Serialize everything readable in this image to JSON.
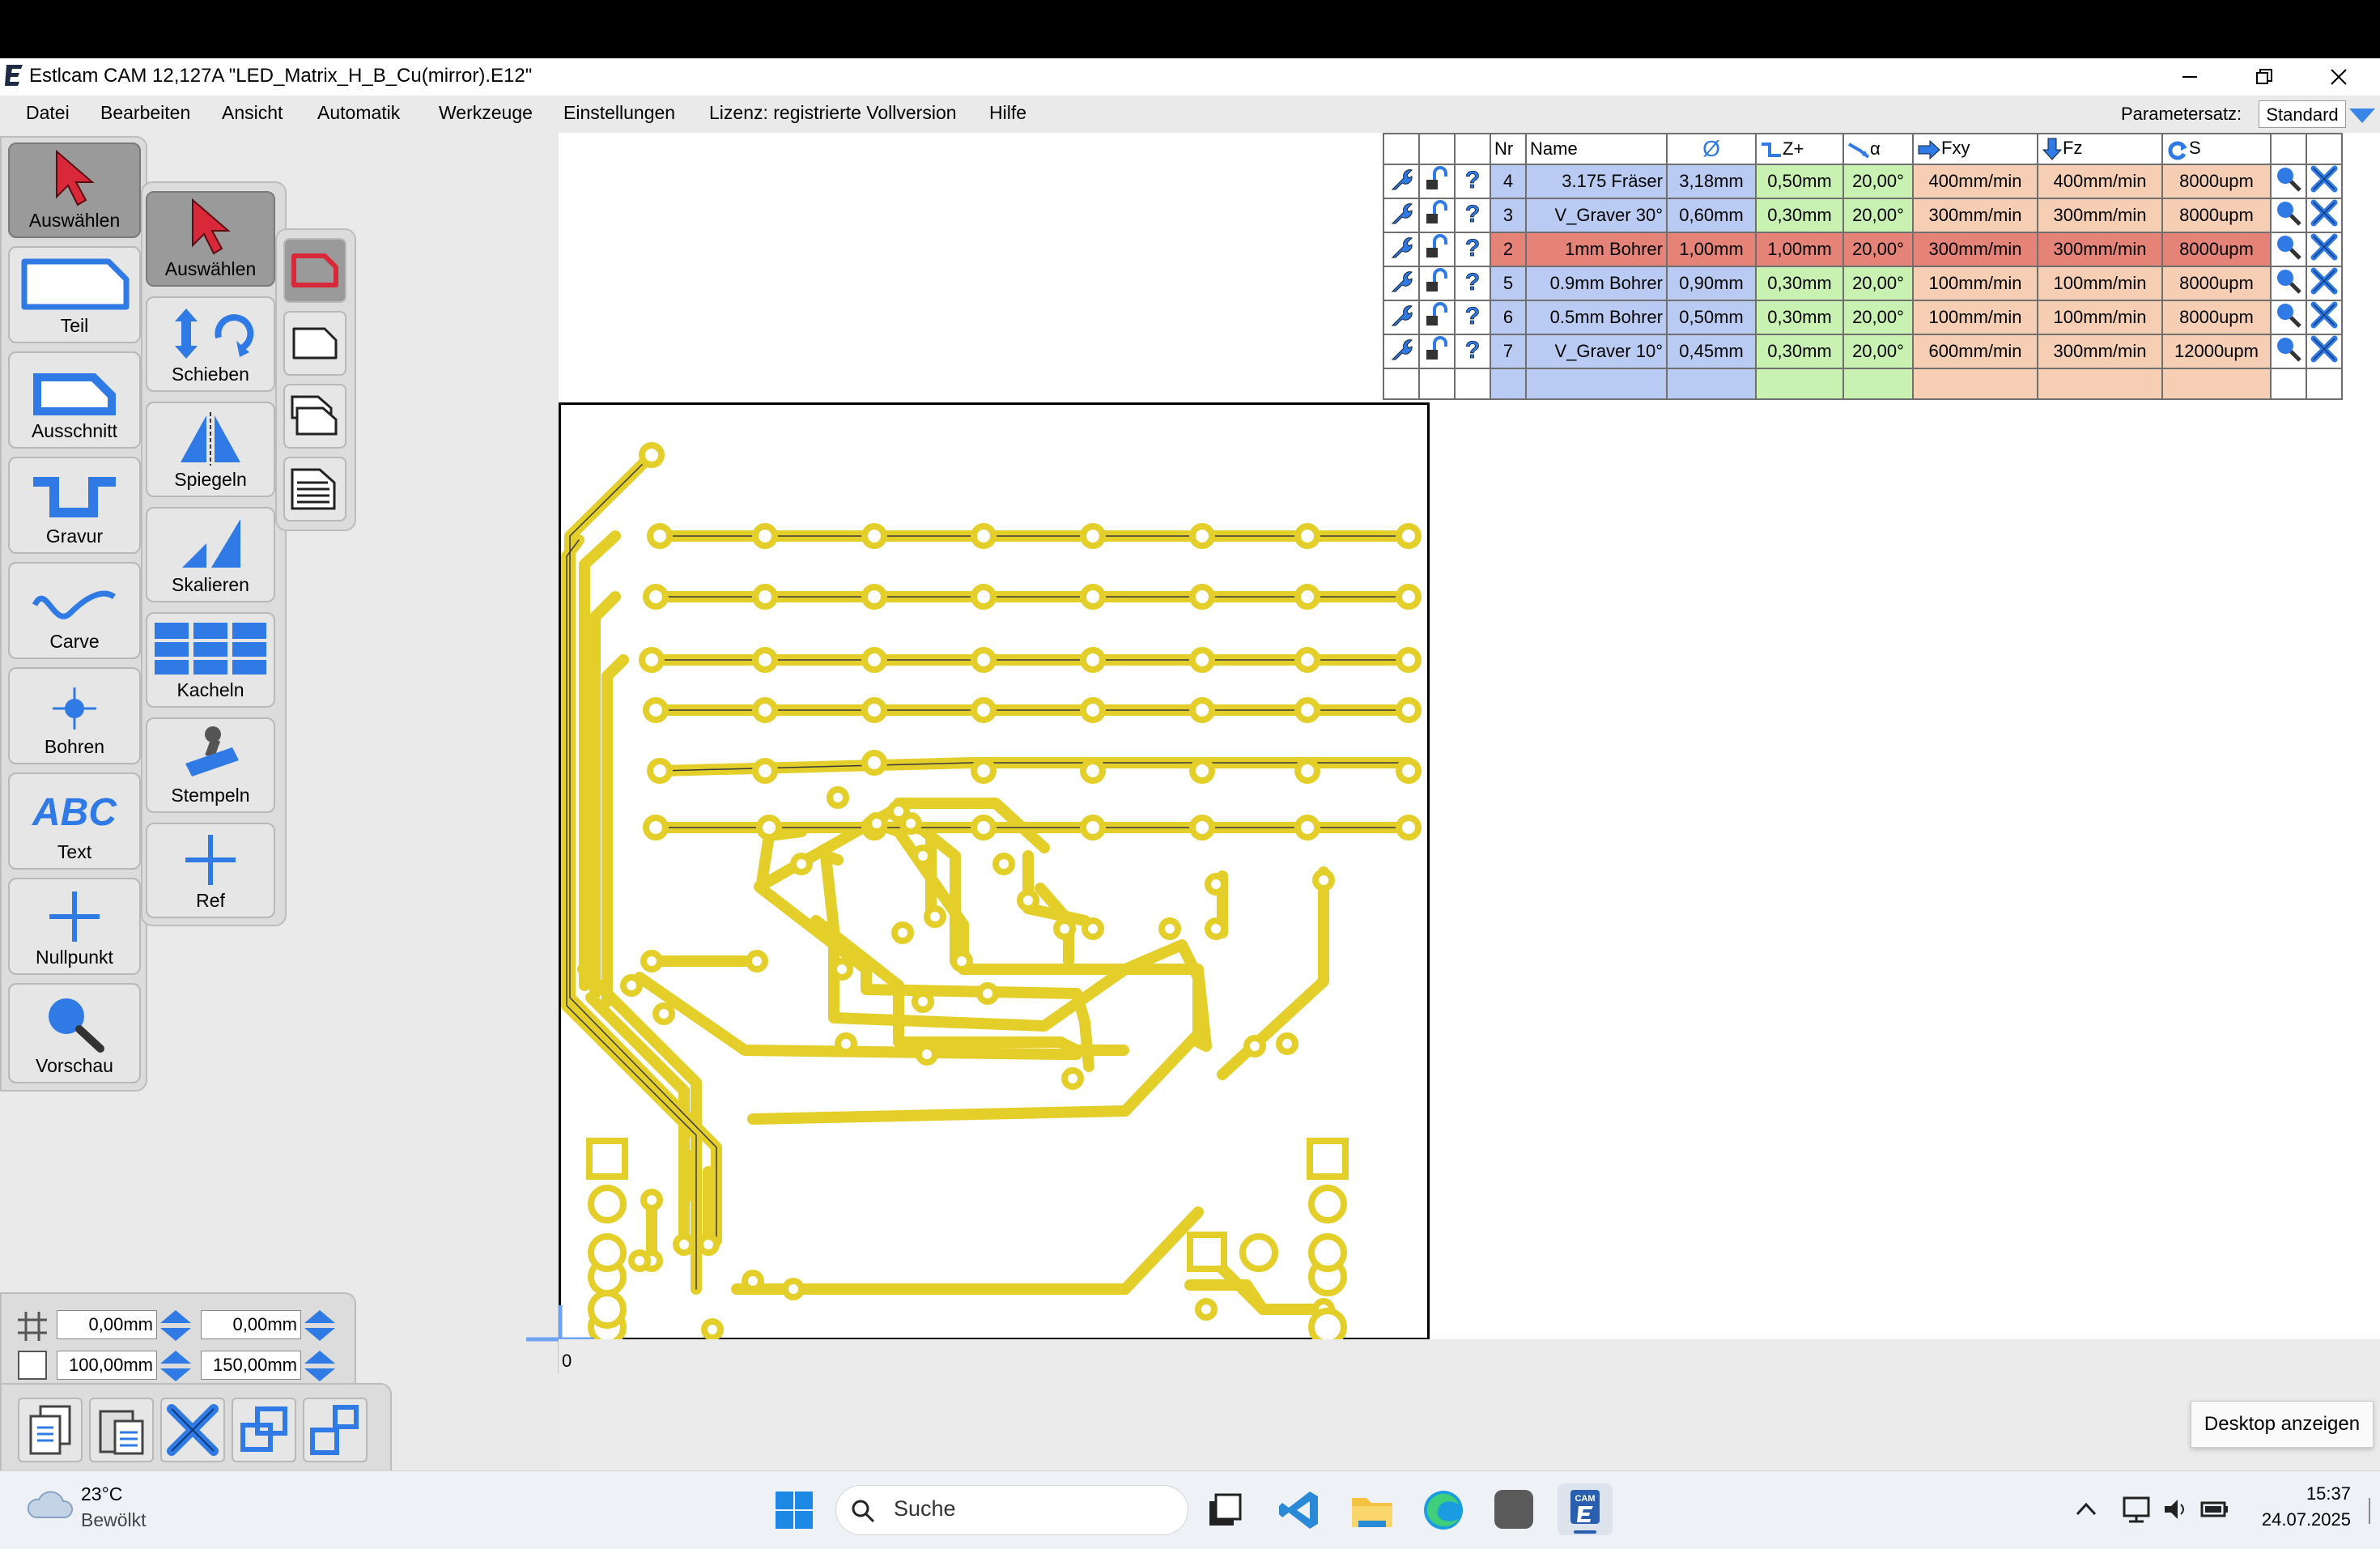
{
  "window": {
    "title": "Estlcam CAM 12,127A \"LED_Matrix_H_B_Cu(mirror).E12\"",
    "controls": [
      "minimize",
      "restore",
      "close"
    ]
  },
  "menu": [
    "Datei",
    "Bearbeiten",
    "Ansicht",
    "Automatik",
    "Werkzeuge",
    "Einstellungen",
    "Lizenz: registrierte Vollversion",
    "Hilfe"
  ],
  "paramset": {
    "label": "Parametersatz:",
    "value": "Standard"
  },
  "toolbar_left": [
    {
      "label": "Auswählen",
      "icon": "cursor-icon",
      "active": true
    },
    {
      "label": "Teil",
      "icon": "part-icon"
    },
    {
      "label": "Ausschnitt",
      "icon": "pocket-icon"
    },
    {
      "label": "Gravur",
      "icon": "engrave-icon"
    },
    {
      "label": "Carve",
      "icon": "carve-icon"
    },
    {
      "label": "Bohren",
      "icon": "drill-icon"
    },
    {
      "label": "Text",
      "icon": "text-icon",
      "glyph": "ABC"
    },
    {
      "label": "Nullpunkt",
      "icon": "zero-point-icon"
    },
    {
      "label": "Vorschau",
      "icon": "preview-icon"
    }
  ],
  "toolbar_right": [
    {
      "label": "Auswählen",
      "icon": "cursor-icon",
      "active": true
    },
    {
      "label": "Schieben",
      "icon": "move-rotate-icon"
    },
    {
      "label": "Spiegeln",
      "icon": "mirror-icon"
    },
    {
      "label": "Skalieren",
      "icon": "scale-icon"
    },
    {
      "label": "Kacheln",
      "icon": "tile-icon"
    },
    {
      "label": "Stempeln",
      "icon": "stamp-icon"
    },
    {
      "label": "Ref",
      "icon": "ref-icon"
    }
  ],
  "tool_table": {
    "headers": {
      "nr": "Nr",
      "name": "Name",
      "diameter": "Ø",
      "z": "Z+",
      "angle": "α",
      "fxy": "Fxy",
      "fz": "Fz",
      "s": "S"
    },
    "rows": [
      {
        "nr": "4",
        "name": "3.175 Fräser",
        "dia": "3,18mm",
        "z": "0,50mm",
        "a": "20,00°",
        "fxy": "400mm/min",
        "fz": "400mm/min",
        "s": "8000upm",
        "selected": false
      },
      {
        "nr": "3",
        "name": "V_Graver 30°",
        "dia": "0,60mm",
        "z": "0,30mm",
        "a": "20,00°",
        "fxy": "300mm/min",
        "fz": "300mm/min",
        "s": "8000upm",
        "selected": false
      },
      {
        "nr": "2",
        "name": "1mm Bohrer",
        "dia": "1,00mm",
        "z": "1,00mm",
        "a": "20,00°",
        "fxy": "300mm/min",
        "fz": "300mm/min",
        "s": "8000upm",
        "selected": true
      },
      {
        "nr": "5",
        "name": "0.9mm Bohrer",
        "dia": "0,90mm",
        "z": "0,30mm",
        "a": "20,00°",
        "fxy": "100mm/min",
        "fz": "100mm/min",
        "s": "8000upm",
        "selected": false
      },
      {
        "nr": "6",
        "name": "0.5mm Bohrer",
        "dia": "0,50mm",
        "z": "0,30mm",
        "a": "20,00°",
        "fxy": "100mm/min",
        "fz": "100mm/min",
        "s": "8000upm",
        "selected": false
      },
      {
        "nr": "7",
        "name": "V_Graver 10°",
        "dia": "0,45mm",
        "z": "0,30mm",
        "a": "20,00°",
        "fxy": "600mm/min",
        "fz": "300mm/min",
        "s": "12000upm",
        "selected": false
      }
    ]
  },
  "canvas": {
    "origin_label": "0"
  },
  "bottom_panel": {
    "grid_x": "0,00mm",
    "grid_y": "0,00mm",
    "size_x": "100,00mm",
    "size_y": "150,00mm"
  },
  "tooltip": "Desktop anzeigen",
  "taskbar": {
    "weather_temp": "23°C",
    "weather_desc": "Bewölkt",
    "search_placeholder": "Suche",
    "time": "15:37",
    "date": "24.07.2025"
  },
  "colors": {
    "accent_blue": "#2f7ae5",
    "trace_yellow": "#f5e21a",
    "selected_row": "#e58378",
    "cursor_red": "#d9283a"
  }
}
